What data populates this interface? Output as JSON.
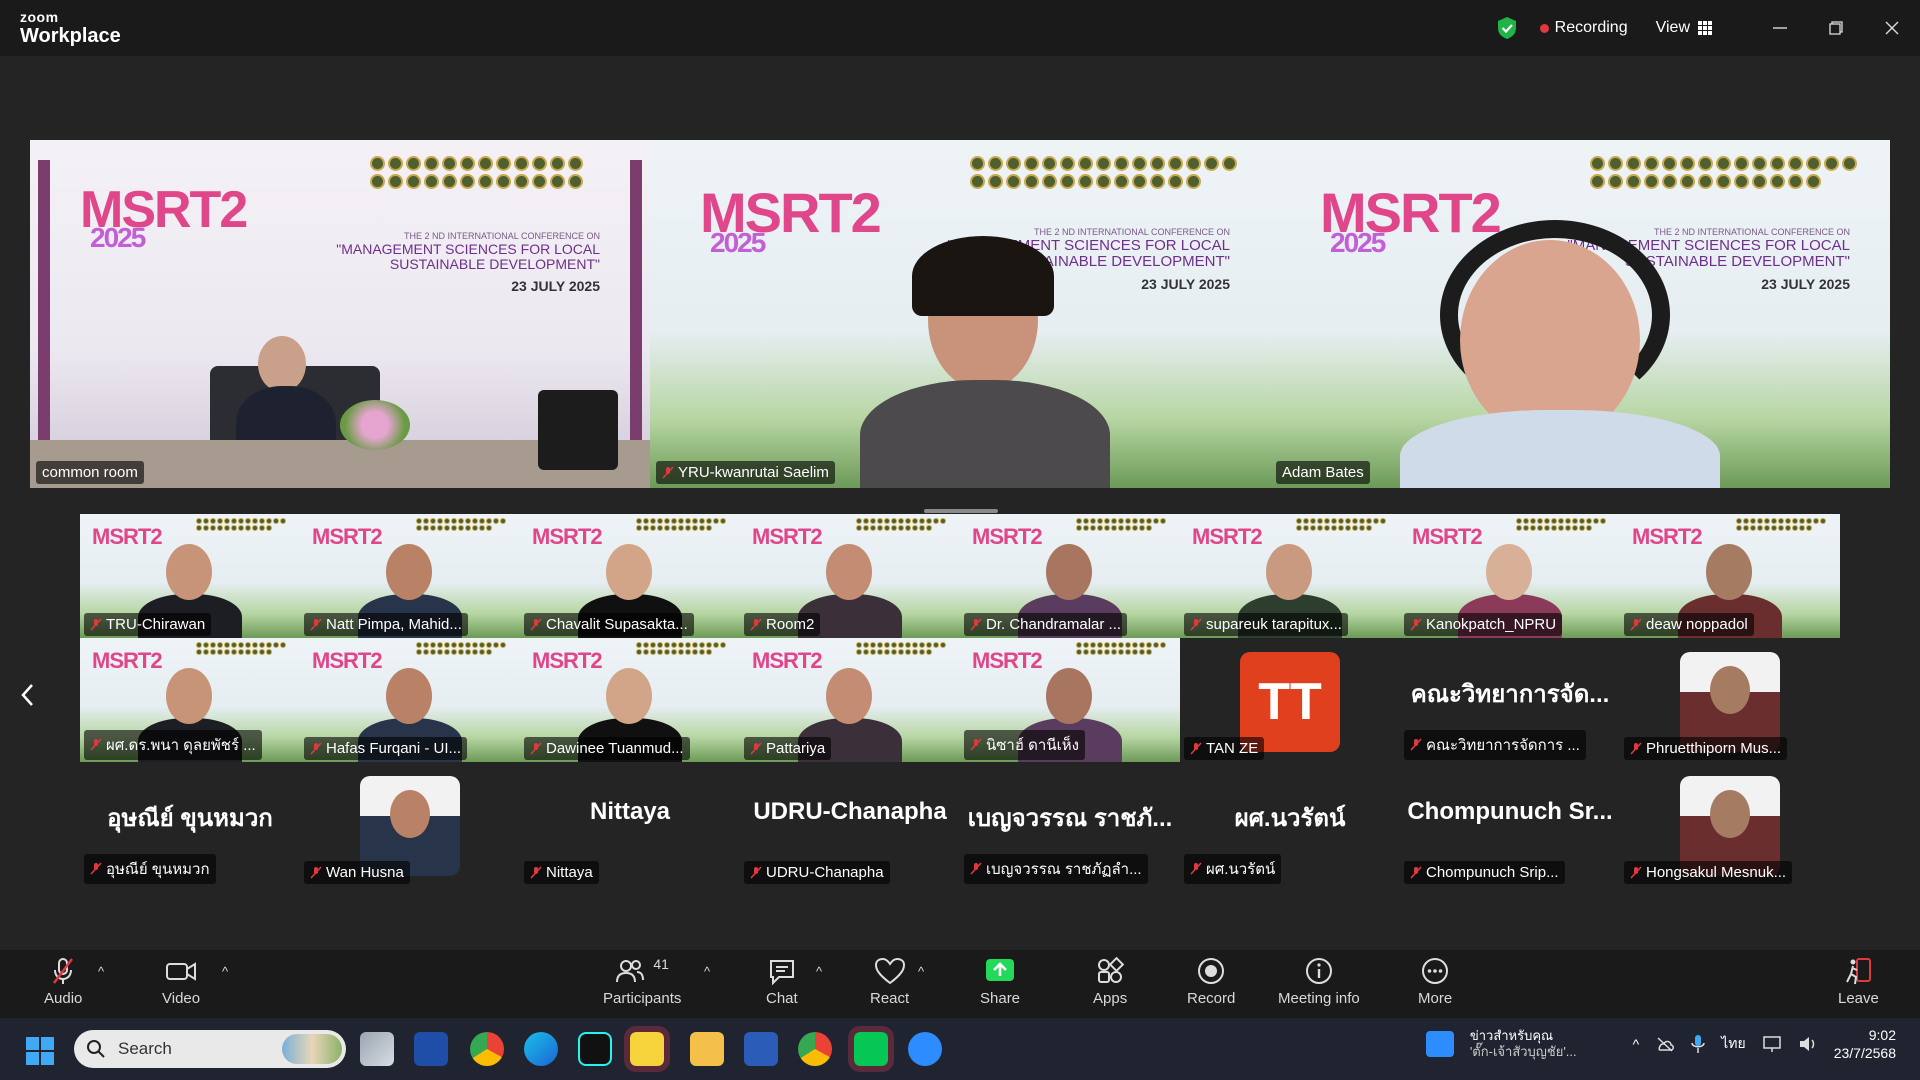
{
  "app": {
    "brand_small": "zoom",
    "brand_large": "Workplace"
  },
  "titlebar": {
    "recording_label": "Recording",
    "view_label": "View"
  },
  "speakers": [
    {
      "name": "common room",
      "active": true
    },
    {
      "name": "YRU-kwanrutai Saelim"
    },
    {
      "name": "Adam Bates"
    }
  ],
  "conference": {
    "logo_text": "MSRT2",
    "year": "2025",
    "line1": "THE 2 ND INTERNATIONAL CONFERENCE ON",
    "line2": "\"MANAGEMENT SCIENCES FOR LOCAL",
    "line3": "SUSTAINABLE DEVELOPMENT\"",
    "date": "23 JULY 2025"
  },
  "gallery": [
    {
      "name": "TRU-Chirawan",
      "kind": "video"
    },
    {
      "name": "Natt Pimpa, Mahid...",
      "kind": "video"
    },
    {
      "name": "Chavalit Supasakta...",
      "kind": "video"
    },
    {
      "name": "Room2",
      "kind": "video"
    },
    {
      "name": "Dr. Chandramalar ...",
      "kind": "video"
    },
    {
      "name": "supareuk tarapitux...",
      "kind": "video"
    },
    {
      "name": "Kanokpatch_NPRU",
      "kind": "video"
    },
    {
      "name": "deaw noppadol",
      "kind": "video"
    },
    {
      "name": "ผศ.ดร.พนา ดุลยพัชร์ ...",
      "kind": "video"
    },
    {
      "name": "Hafas Furqani - UI...",
      "kind": "video"
    },
    {
      "name": "Dawinee Tuanmud...",
      "kind": "video"
    },
    {
      "name": "Pattariya",
      "kind": "video"
    },
    {
      "name": "นิซาฮ์ ดานีเห็ง",
      "kind": "video"
    },
    {
      "name": "TAN ZE",
      "kind": "initials",
      "initials": "TT"
    },
    {
      "name": "คณะวิทยาการจัดการ ...",
      "kind": "text",
      "display": "คณะวิทยาการจัด..."
    },
    {
      "name": "Phruetthiporn Mus...",
      "kind": "photo"
    },
    {
      "name": "อุษณีย์ ขุนหมวก",
      "kind": "text",
      "display": "อุษณีย์ ขุนหมวก"
    },
    {
      "name": "Wan Husna",
      "kind": "photo"
    },
    {
      "name": "Nittaya",
      "kind": "text",
      "display": "Nittaya"
    },
    {
      "name": "UDRU-Chanapha",
      "kind": "text",
      "display": "UDRU-Chanapha"
    },
    {
      "name": "เบญจวรรณ ราชภัฏลำ...",
      "kind": "text",
      "display": "เบญจวรรณ ราชภั..."
    },
    {
      "name": "ผศ.นวรัตน์",
      "kind": "text",
      "display": "ผศ.นวรัตน์"
    },
    {
      "name": "Chompunuch Srip...",
      "kind": "text",
      "display": "Chompunuch Sr..."
    },
    {
      "name": "Hongsakul Mesnuk...",
      "kind": "photo"
    }
  ],
  "toolbar": {
    "audio": "Audio",
    "video": "Video",
    "participants": "Participants",
    "participant_count": "41",
    "chat": "Chat",
    "react": "React",
    "share": "Share",
    "apps": "Apps",
    "record": "Record",
    "meeting_info": "Meeting info",
    "more": "More",
    "leave": "Leave"
  },
  "taskbar": {
    "search_placeholder": "Search",
    "news_line1": "ข่าวสำหรับคุณ",
    "news_line2": "'ตั๊ก-เจ้าสัวบุญชัย'...",
    "language": "ไทย",
    "time": "9:02",
    "date": "23/7/2568"
  },
  "colors": {
    "accent_green": "#23d959",
    "record_red": "#e0383e",
    "share_green": "#23d959",
    "leave_red": "#e0383e"
  }
}
